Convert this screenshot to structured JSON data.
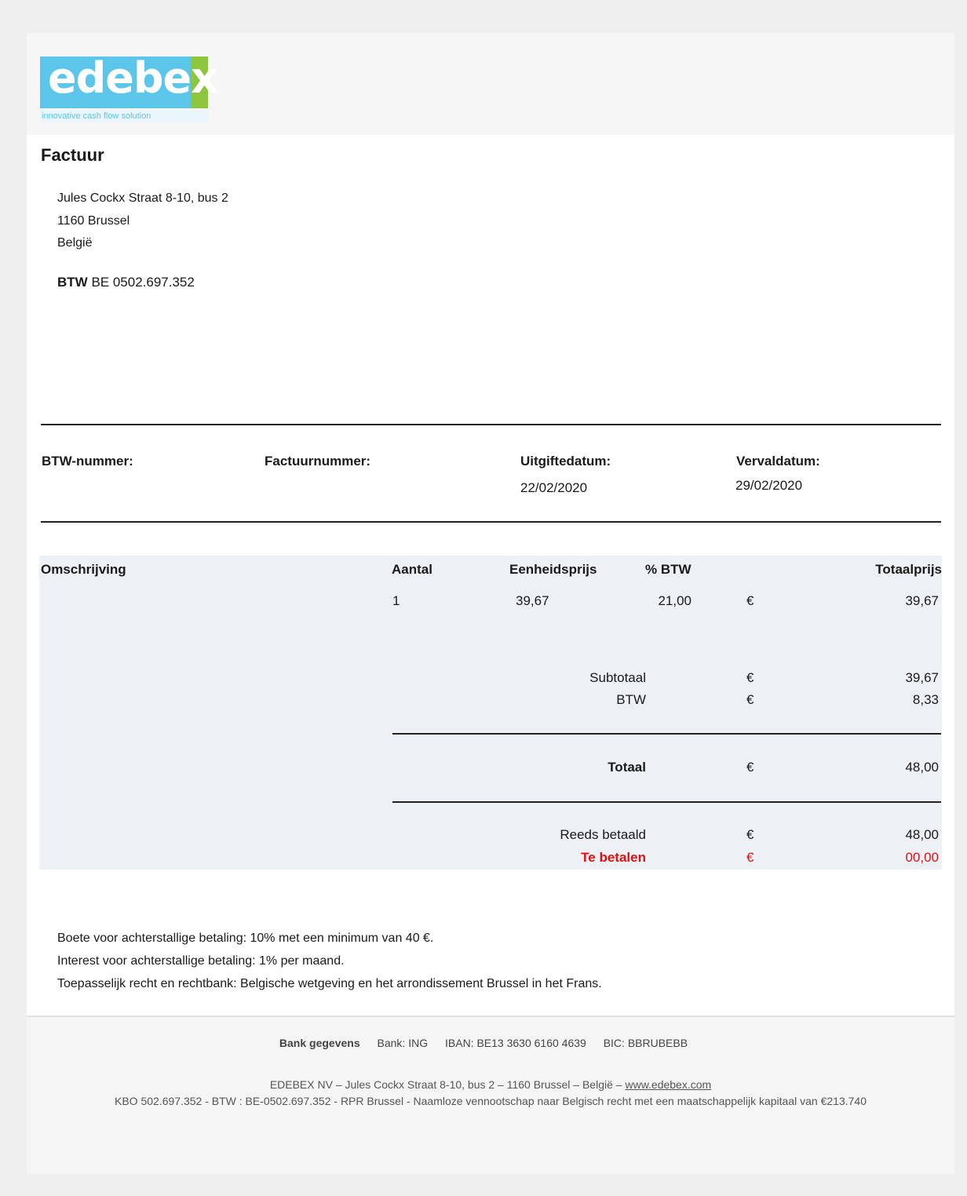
{
  "logo": {
    "word": "edebex",
    "tagline": "innovative cash flow solution",
    "brand_blue": "#5bc6ea",
    "brand_green": "#8cc63f"
  },
  "document": {
    "title": "Factuur"
  },
  "address": {
    "line1": "Jules Cockx Straat 8-10, bus 2",
    "line2": "1160 Brussel",
    "line3": "België"
  },
  "vat": {
    "label": "BTW",
    "value": "BE 0502.697.352"
  },
  "meta": {
    "vat_number_label": "BTW-nummer:",
    "invoice_number_label": "Factuurnummer:",
    "issue_date_label": "Uitgiftedatum:",
    "issue_date": "22/02/2020",
    "due_date_label": "Vervaldatum:",
    "due_date": "29/02/2020"
  },
  "table": {
    "headers": [
      "Omschrijving",
      "Aantal",
      "Eenheidsprijs",
      "% BTW",
      "Totaalprijs"
    ],
    "rows": [
      {
        "description": "",
        "quantity": "1",
        "unit_price": "39,67",
        "vat_pct": "21,00",
        "currency": "€",
        "total": "39,67"
      }
    ]
  },
  "totals": {
    "subtotal_label": "Subtotaal",
    "subtotal_currency": "€",
    "subtotal": "39,67",
    "vat_label": "BTW",
    "vat_currency": "€",
    "vat": "8,33",
    "total_label": "Totaal",
    "total_currency": "€",
    "total": "48,00",
    "paid_label": "Reeds betaald",
    "paid_currency": "€",
    "paid": "48,00",
    "due_label": "Te betalen",
    "due_currency": "€",
    "due": "00,00",
    "due_color": "#e01010"
  },
  "terms": {
    "line1": "Boete voor achterstallige betaling: 10% met een minimum van 40 €.",
    "line2": "Interest voor achterstallige betaling: 1% per maand.",
    "line3": "Toepasselijk recht en rechtbank: Belgische wetgeving en het arrondissement Brussel in het Frans."
  },
  "footer": {
    "bank_label": "Bank gegevens",
    "bank": "Bank: ING",
    "iban": "IBAN: BE13 3630 6160 4639",
    "bic": "BIC: BBRUBEBB",
    "company_line": "EDEBEX NV – Jules Cockx Straat 8-10, bus 2 – 1160 Brussel – België –",
    "website": "www.edebex.com",
    "legal_line": "KBO 502.697.352 - BTW : BE-0502.697.352 - RPR Brussel - Naamloze vennootschap naar Belgisch recht met een maatschappelijk kapitaal van €213.740"
  }
}
